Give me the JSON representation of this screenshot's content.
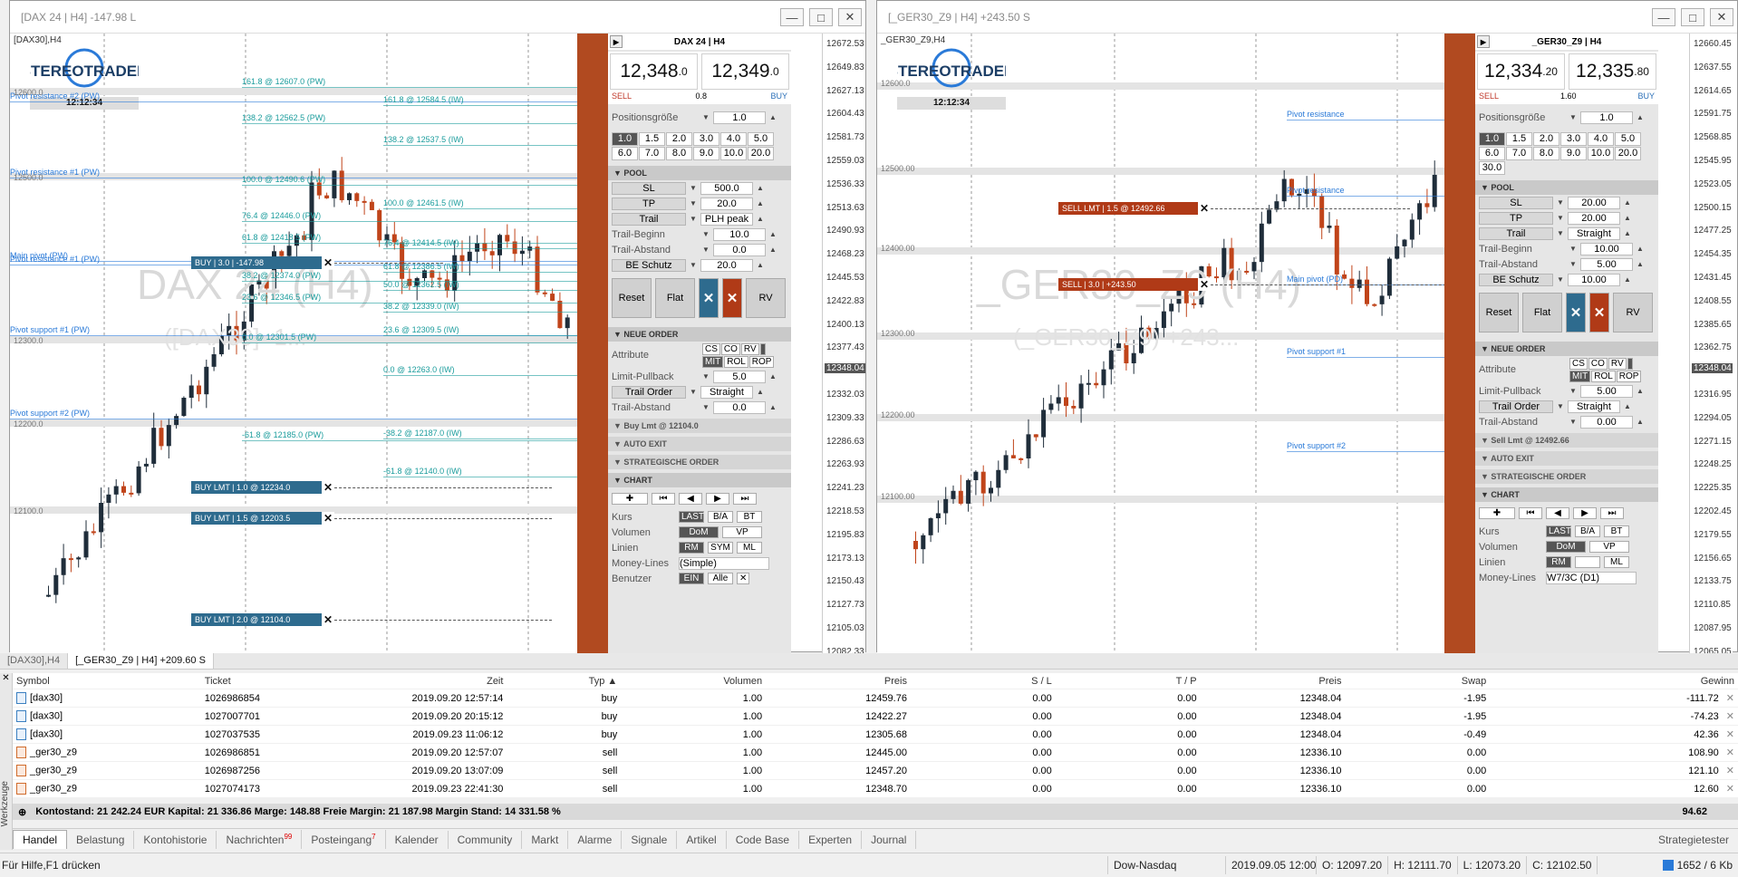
{
  "left_window": {
    "title": "[DAX 24 | H4] -147.98 L",
    "chart_label": "[DAX30],H4",
    "clock": "12:12:34",
    "watermark": "DAX 24 (H4)",
    "watermark_sub": "([DAX30] -1...",
    "levels": [
      {
        "text": "161.8 @ 12607.0 (PW)",
        "cls": "teal"
      },
      {
        "text": "Pivot resistance #2 (PW)",
        "cls": "blue"
      },
      {
        "text": "161.8 @ 12584.5 (IW)",
        "cls": "teal"
      },
      {
        "text": "138.2 @ 12562.5 (PW)",
        "cls": "teal"
      },
      {
        "text": "138.2 @ 12537.5 (IW)",
        "cls": "teal"
      },
      {
        "text": "Pivot resistance #1 (PW)",
        "cls": "blue"
      },
      {
        "text": "100.0 @ 12490.6 (PW)",
        "cls": "teal"
      },
      {
        "text": "100.0 @ 12461.5 (IW)",
        "cls": "teal"
      },
      {
        "text": "76.4 @ 12446.0 (PW)",
        "cls": "teal"
      },
      {
        "text": "61.8 @ 12418.5 (PW)",
        "cls": "teal"
      },
      {
        "text": "76.4 @ 12414.5 (IW)",
        "cls": "teal"
      },
      {
        "text": "Main pivot (PW)",
        "cls": "blue"
      },
      {
        "text": "Pivot resistance #1 (PW)",
        "cls": "blue"
      },
      {
        "text": "61.8 @ 12386.5 (IW)",
        "cls": "teal"
      },
      {
        "text": "38.2 @ 12374.0 (PW)",
        "cls": "teal"
      },
      {
        "text": "50.0 @ 12362.5 (IW)",
        "cls": "teal"
      },
      {
        "text": "23.6 @ 12346.5 (PW)",
        "cls": "teal"
      },
      {
        "text": "38.2 @ 12339.0 (IW)",
        "cls": "teal"
      },
      {
        "text": "Pivot support #1 (PW)",
        "cls": "blue"
      },
      {
        "text": "23.6 @ 12309.5 (IW)",
        "cls": "teal"
      },
      {
        "text": "0.0 @ 12301.5 (PW)",
        "cls": "teal"
      },
      {
        "text": "0.0 @ 12263.0 (IW)",
        "cls": "teal"
      },
      {
        "text": "Pivot support #2 (PW)",
        "cls": "blue"
      },
      {
        "text": "-38.2 @ 12187.0 (IW)",
        "cls": "teal"
      },
      {
        "text": "-61.8 @ 12185.0 (PW)",
        "cls": "teal"
      },
      {
        "text": "-61.8 @ 12140.0 (IW)",
        "cls": "teal"
      }
    ],
    "price_labels": [
      "12600.0",
      "12500.0",
      "12300.0",
      "12200.0",
      "12100.0"
    ],
    "orders": [
      {
        "text": "BUY | 3.0 | -147.98",
        "kind": "blue"
      },
      {
        "text": "BUY LMT | 1.0 @ 12234.0",
        "kind": "blue"
      },
      {
        "text": "BUY LMT | 1.5 @ 12203.5",
        "kind": "blue"
      },
      {
        "text": "BUY LMT | 2.0 @ 12104.0",
        "kind": "blue"
      }
    ],
    "axis": [
      "12672.53",
      "12649.83",
      "12627.13",
      "12604.43",
      "12581.73",
      "12559.03",
      "12536.33",
      "12513.63",
      "12490.93",
      "12468.23",
      "12445.53",
      "12422.83",
      "12400.13",
      "12377.43",
      "12354.73",
      "12332.03",
      "12309.33",
      "12286.63",
      "12263.93",
      "12241.23",
      "12218.53",
      "12195.83",
      "12173.13",
      "12150.43",
      "12127.73",
      "12105.03",
      "12082.33"
    ],
    "axis_current": "12348.04"
  },
  "right_window": {
    "title": "[_GER30_Z9 | H4] +243.50 S",
    "chart_label": "_GER30_Z9,H4",
    "clock": "12:12:34",
    "watermark": "_GER30_Z9 (H4)",
    "watermark_sub": "(_GER30_Z9) +243...",
    "levels": [
      {
        "text": "Pivot resistance",
        "cls": "blue"
      },
      {
        "text": "Pivot resistance",
        "cls": "blue"
      },
      {
        "text": "Main pivot (PD)",
        "cls": "blue"
      },
      {
        "text": "Pivot support #1",
        "cls": "blue"
      },
      {
        "text": "Pivot support #2",
        "cls": "blue"
      }
    ],
    "price_labels": [
      "12600.0",
      "12500.00",
      "12400.00",
      "12300.00",
      "12200.00",
      "12100.00"
    ],
    "orders": [
      {
        "text": "SELL LMT | 1.5 @ 12492.66",
        "kind": "red"
      },
      {
        "text": "SELL | 3.0 | +243.50",
        "kind": "red"
      }
    ],
    "axis": [
      "12660.45",
      "12637.55",
      "12614.65",
      "12591.75",
      "12568.85",
      "12545.95",
      "12523.05",
      "12500.15",
      "12477.25",
      "12454.35",
      "12431.45",
      "12408.55",
      "12385.65",
      "12362.75",
      "12339.85",
      "12316.95",
      "12294.05",
      "12271.15",
      "12248.25",
      "12225.35",
      "12202.45",
      "12179.55",
      "12156.65",
      "12133.75",
      "12110.85",
      "12087.95",
      "12065.05"
    ],
    "axis_current": "12348.04"
  },
  "left_panel": {
    "header": "DAX 24 | H4",
    "sell_big": "12,348",
    "sell_small": ".0",
    "buy_big": "12,349",
    "buy_small": ".0",
    "sell_label": "SELL",
    "spread": "0.8",
    "buy_label": "BUY",
    "position_label": "Positionsgröße",
    "position_value": "1.0",
    "sizes": [
      "1.0",
      "1.5",
      "2.0",
      "3.0",
      "4.0",
      "5.0",
      "6.0",
      "7.0",
      "8.0",
      "9.0",
      "10.0",
      "20.0"
    ],
    "pool_label": "POOL",
    "sl_label": "SL",
    "sl_value": "500.0",
    "tp_label": "TP",
    "tp_value": "20.0",
    "trail_label": "Trail",
    "trail_value": "PLH peak",
    "trail_begin_label": "Trail-Beginn",
    "trail_begin_value": "10.0",
    "trail_dist_label": "Trail-Abstand",
    "trail_dist_value": "0.0",
    "be_label": "BE Schutz",
    "be_value": "20.0",
    "reset": "Reset",
    "flat": "Flat",
    "rv": "RV",
    "new_order": "NEUE ORDER",
    "attribute_label": "Attribute",
    "attr_tags": [
      "CS",
      "CO",
      "RV",
      "",
      "MIT",
      "ROL",
      "ROP"
    ],
    "limit_pullback_label": "Limit-Pullback",
    "limit_pullback_value": "5.0",
    "trail_order_label": "Trail Order",
    "trail_order_value": "Straight",
    "trail_abstand2_label": "Trail-Abstand",
    "trail_abstand2_value": "0.0",
    "pending_section": "Buy Lmt @ 12104.0",
    "auto_exit": "AUTO EXIT",
    "strategic": "STRATEGISCHE ORDER",
    "chart_section": "CHART",
    "kurs_label": "Kurs",
    "kurs_tags": [
      "LAST",
      "B/A",
      "BT"
    ],
    "vol_label": "Volumen",
    "vol_tags": [
      "DoM",
      "VP"
    ],
    "lines_label": "Linien",
    "lines_tags": [
      "RM",
      "SYM",
      "ML"
    ],
    "money_label": "Money-Lines",
    "money_value": "(Simple)",
    "user_label": "Benutzer",
    "user_tags": [
      "EIN",
      "Alle"
    ]
  },
  "right_panel": {
    "header": "_GER30_Z9 | H4",
    "sell_big": "12,334",
    "sell_small": ".20",
    "buy_big": "12,335",
    "buy_small": ".80",
    "sell_label": "SELL",
    "spread": "1.60",
    "buy_label": "BUY",
    "position_label": "Positionsgröße",
    "position_value": "1.0",
    "sizes": [
      "1.0",
      "1.5",
      "2.0",
      "3.0",
      "4.0",
      "5.0",
      "6.0",
      "7.0",
      "8.0",
      "9.0",
      "10.0",
      "20.0",
      "30.0"
    ],
    "pool_label": "POOL",
    "sl_label": "SL",
    "sl_value": "20.00",
    "tp_label": "TP",
    "tp_value": "20.00",
    "trail_label": "Trail",
    "trail_value": "Straight",
    "trail_begin_label": "Trail-Beginn",
    "trail_begin_value": "10.00",
    "trail_dist_label": "Trail-Abstand",
    "trail_dist_value": "5.00",
    "be_label": "BE Schutz",
    "be_value": "10.00",
    "reset": "Reset",
    "flat": "Flat",
    "rv": "RV",
    "new_order": "NEUE ORDER",
    "attribute_label": "Attribute",
    "attr_tags": [
      "CS",
      "CO",
      "RV",
      "",
      "MIT",
      "ROL",
      "ROP"
    ],
    "limit_pullback_label": "Limit-Pullback",
    "limit_pullback_value": "5.00",
    "trail_order_label": "Trail Order",
    "trail_order_value": "Straight",
    "trail_abstand2_label": "Trail-Abstand",
    "trail_abstand2_value": "0.00",
    "pending_section": "Sell Lmt @ 12492.66",
    "auto_exit": "AUTO EXIT",
    "strategic": "STRATEGISCHE ORDER",
    "chart_section": "CHART",
    "kurs_label": "Kurs",
    "kurs_tags": [
      "LAST",
      "B/A",
      "BT"
    ],
    "vol_label": "Volumen",
    "vol_tags": [
      "DoM",
      "VP"
    ],
    "lines_label": "Linien",
    "lines_tags": [
      "RM",
      "",
      "ML"
    ],
    "money_label": "Money-Lines",
    "money_value": "W7/3C (D1)"
  },
  "chart_tabs": [
    "[DAX30],H4",
    "[_GER30_Z9 | H4] +209.60 S"
  ],
  "table": {
    "headers": [
      "Symbol",
      "Ticket",
      "Zeit",
      "Typ",
      "Volumen",
      "Preis",
      "S / L",
      "T / P",
      "Preis",
      "Swap",
      "Gewinn"
    ],
    "rows": [
      {
        "side": "buy",
        "cells": [
          "[dax30]",
          "1026986854",
          "2019.09.20 12:57:14",
          "buy",
          "1.00",
          "12459.76",
          "0.00",
          "0.00",
          "12348.04",
          "-1.95",
          "-111.72"
        ]
      },
      {
        "side": "buy",
        "cells": [
          "[dax30]",
          "1027007701",
          "2019.09.20 20:15:12",
          "buy",
          "1.00",
          "12422.27",
          "0.00",
          "0.00",
          "12348.04",
          "-1.95",
          "-74.23"
        ]
      },
      {
        "side": "buy",
        "cells": [
          "[dax30]",
          "1027037535",
          "2019.09.23 11:06:12",
          "buy",
          "1.00",
          "12305.68",
          "0.00",
          "0.00",
          "12348.04",
          "-0.49",
          "42.36"
        ]
      },
      {
        "side": "sell",
        "cells": [
          "_ger30_z9",
          "1026986851",
          "2019.09.20 12:57:07",
          "sell",
          "1.00",
          "12445.00",
          "0.00",
          "0.00",
          "12336.10",
          "0.00",
          "108.90"
        ]
      },
      {
        "side": "sell",
        "cells": [
          "_ger30_z9",
          "1026987256",
          "2019.09.20 13:07:09",
          "sell",
          "1.00",
          "12457.20",
          "0.00",
          "0.00",
          "12336.10",
          "0.00",
          "121.10"
        ]
      },
      {
        "side": "sell",
        "cells": [
          "_ger30_z9",
          "1027074173",
          "2019.09.23 22:41:30",
          "sell",
          "1.00",
          "12348.70",
          "0.00",
          "0.00",
          "12336.10",
          "0.00",
          "12.60"
        ]
      }
    ],
    "summary": "Kontostand: 21 242.24 EUR  Kapital: 21 336.86  Marge: 148.88  Freie Margin: 21 187.98  Margin Stand: 14 331.58 %",
    "summary_total": "94.62"
  },
  "sidebar_label": "Werkzeuge",
  "bottom_tabs": [
    {
      "label": "Handel",
      "badge": ""
    },
    {
      "label": "Belastung",
      "badge": ""
    },
    {
      "label": "Kontohistorie",
      "badge": ""
    },
    {
      "label": "Nachrichten",
      "badge": "99"
    },
    {
      "label": "Posteingang",
      "badge": "7"
    },
    {
      "label": "Kalender",
      "badge": ""
    },
    {
      "label": "Community",
      "badge": ""
    },
    {
      "label": "Markt",
      "badge": ""
    },
    {
      "label": "Alarme",
      "badge": ""
    },
    {
      "label": "Signale",
      "badge": ""
    },
    {
      "label": "Artikel",
      "badge": ""
    },
    {
      "label": "Code Base",
      "badge": ""
    },
    {
      "label": "Experten",
      "badge": ""
    },
    {
      "label": "Journal",
      "badge": ""
    }
  ],
  "strategy_tester": "Strategietester",
  "status": {
    "help": "Für Hilfe,F1 drücken",
    "profile": "Dow-Nasdaq",
    "datetime": "2019.09.05 12:00",
    "open": "O: 12097.20",
    "high": "H: 12111.70",
    "low": "L: 12073.20",
    "close": "C: 12102.50",
    "traffic": "1652 / 6 Kb"
  },
  "colors": {
    "bull": "#1f2d3a",
    "bear": "#c0441a",
    "accent_blue": "#2e6b8e",
    "accent_red": "#b03a17",
    "level_blue": "#2a7ad8",
    "level_teal": "#1a9c9c"
  }
}
